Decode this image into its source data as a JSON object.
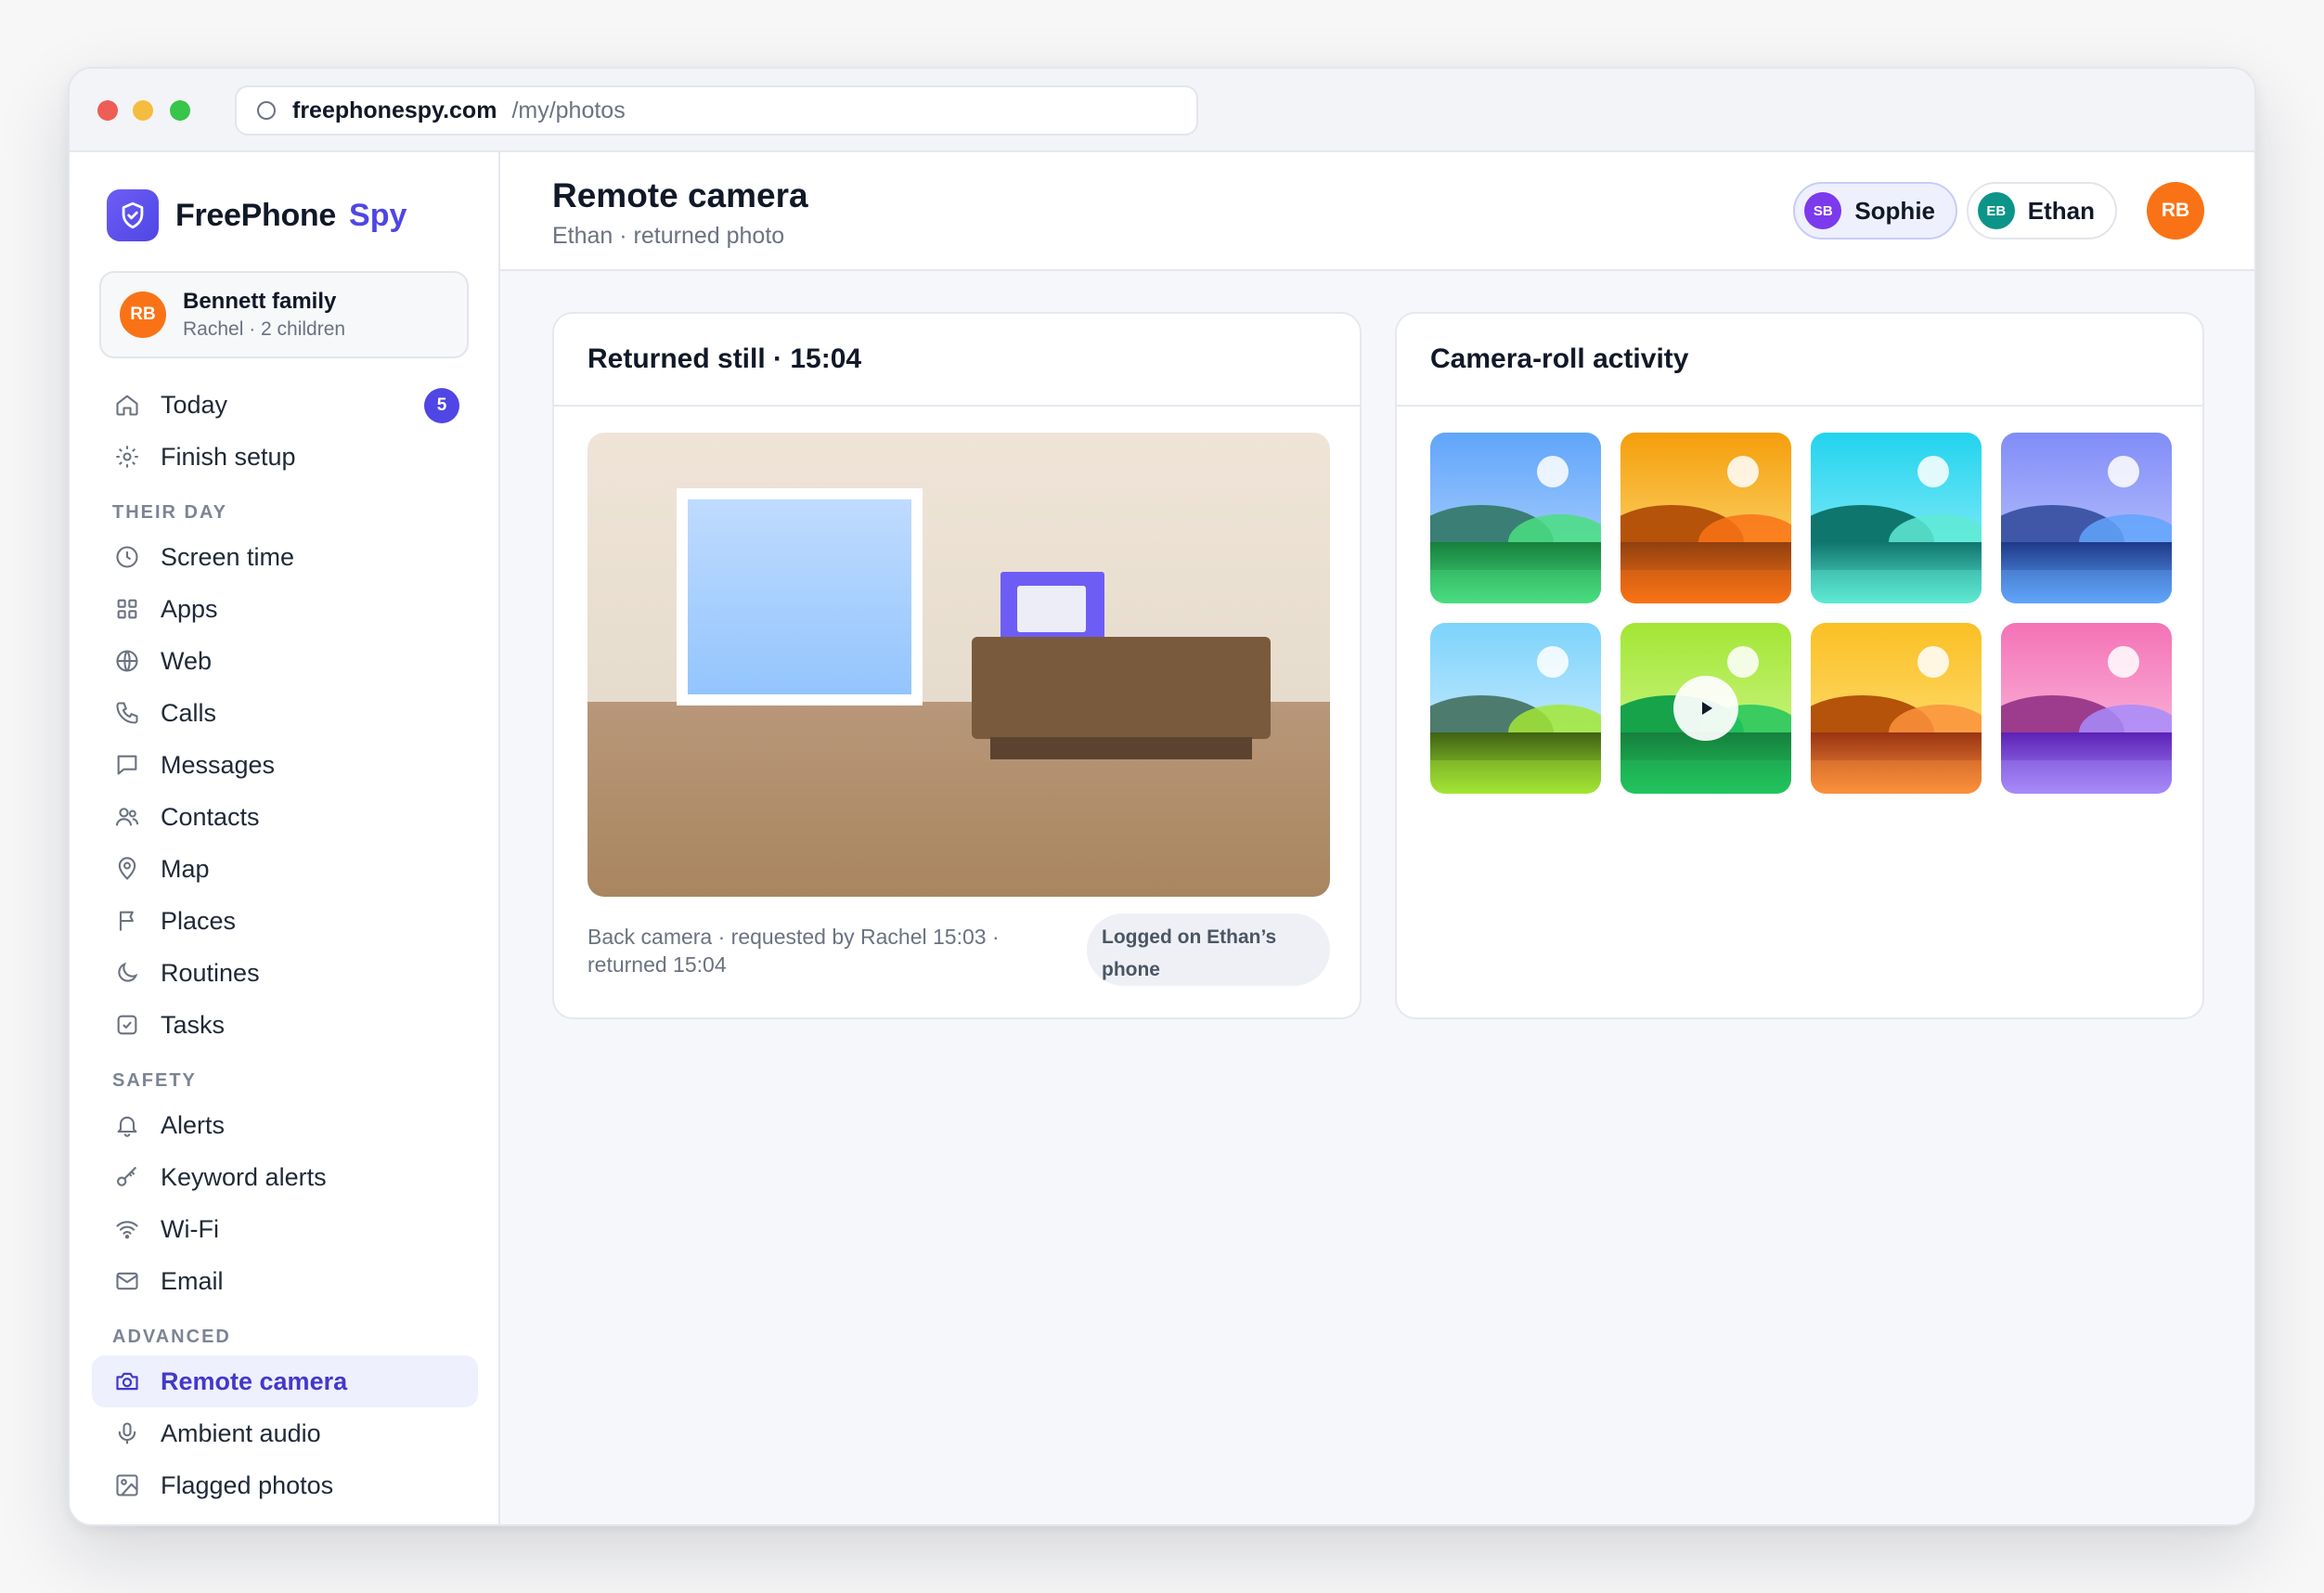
{
  "browser": {
    "domain": "freephonespy.com",
    "path": "/my/photos"
  },
  "brand": {
    "name": "FreePhone",
    "accent": "Spy",
    "accent_color": "#4f46e5"
  },
  "family": {
    "initials": "RB",
    "name": "Bennett family",
    "sub": "Rachel · 2 children"
  },
  "nav": {
    "today": {
      "label": "Today",
      "badge": "5",
      "icon": "home-icon"
    },
    "finish_setup": {
      "label": "Finish setup",
      "icon": "gear-icon"
    },
    "section_their_day": "THEIR DAY",
    "screen_time": {
      "label": "Screen time",
      "icon": "clock-icon"
    },
    "apps": {
      "label": "Apps",
      "icon": "grid-icon"
    },
    "web": {
      "label": "Web",
      "icon": "globe-icon"
    },
    "calls": {
      "label": "Calls",
      "icon": "phone-icon"
    },
    "messages": {
      "label": "Messages",
      "icon": "chat-icon"
    },
    "contacts": {
      "label": "Contacts",
      "icon": "people-icon"
    },
    "map": {
      "label": "Map",
      "icon": "pin-icon"
    },
    "places": {
      "label": "Places",
      "icon": "flag-icon"
    },
    "routines": {
      "label": "Routines",
      "icon": "moon-icon"
    },
    "tasks": {
      "label": "Tasks",
      "icon": "checkbox-icon"
    },
    "section_safety": "SAFETY",
    "alerts": {
      "label": "Alerts",
      "icon": "bell-icon"
    },
    "keyword_alerts": {
      "label": "Keyword alerts",
      "icon": "key-icon"
    },
    "wifi": {
      "label": "Wi-Fi",
      "icon": "wifi-icon"
    },
    "email": {
      "label": "Email",
      "icon": "mail-icon"
    },
    "section_advanced": "ADVANCED",
    "remote_camera": {
      "label": "Remote camera",
      "icon": "camera-icon",
      "active": true
    },
    "ambient_audio": {
      "label": "Ambient audio",
      "icon": "mic-icon"
    },
    "flagged_photos": {
      "label": "Flagged photos",
      "icon": "image-icon"
    }
  },
  "header": {
    "title": "Remote camera",
    "subtitle": "Ethan · returned photo",
    "children": [
      {
        "initials": "SB",
        "name": "Sophie",
        "color": "#7c3aed",
        "selected": true
      },
      {
        "initials": "EB",
        "name": "Ethan",
        "color": "#0d9488",
        "selected": false
      }
    ],
    "user_initials": "RB"
  },
  "returned_still": {
    "title": "Returned still · 15:04",
    "caption": "Back camera · requested by Rachel 15:03 · returned 15:04",
    "status": "Logged on Ethan’s phone"
  },
  "camera_roll": {
    "title": "Camera-roll activity",
    "thumbs": [
      {
        "sky": [
          "#60a5fa",
          "#bfdbfe"
        ],
        "hill": "#3b7e75",
        "ground": [
          "#15803d",
          "#4ade80"
        ],
        "video": false
      },
      {
        "sky": [
          "#f59e0b",
          "#fde68a"
        ],
        "hill": "#b45309",
        "ground": [
          "#92400e",
          "#f97316"
        ],
        "video": false
      },
      {
        "sky": [
          "#22d3ee",
          "#a5f3fc"
        ],
        "hill": "#0f766e",
        "ground": [
          "#0f766e",
          "#5eead4"
        ],
        "video": false
      },
      {
        "sky": [
          "#818cf8",
          "#c7d2fe"
        ],
        "hill": "#4057a8",
        "ground": [
          "#1e3a8a",
          "#60a5fa"
        ],
        "video": false
      },
      {
        "sky": [
          "#7dd3fc",
          "#e0f2fe"
        ],
        "hill": "#4d7c6f",
        "ground": [
          "#3f6212",
          "#a3e635"
        ],
        "video": false
      },
      {
        "sky": [
          "#a3e635",
          "#d9f99d"
        ],
        "hill": "#16a34a",
        "ground": [
          "#15803d",
          "#22c55e"
        ],
        "video": true
      },
      {
        "sky": [
          "#fbbf24",
          "#fde68a"
        ],
        "hill": "#b45309",
        "ground": [
          "#9a3412",
          "#fb923c"
        ],
        "video": false
      },
      {
        "sky": [
          "#f472b6",
          "#fbcfe8"
        ],
        "hill": "#9d3c8c",
        "ground": [
          "#5b21b6",
          "#a78bfa"
        ],
        "video": false
      }
    ]
  }
}
